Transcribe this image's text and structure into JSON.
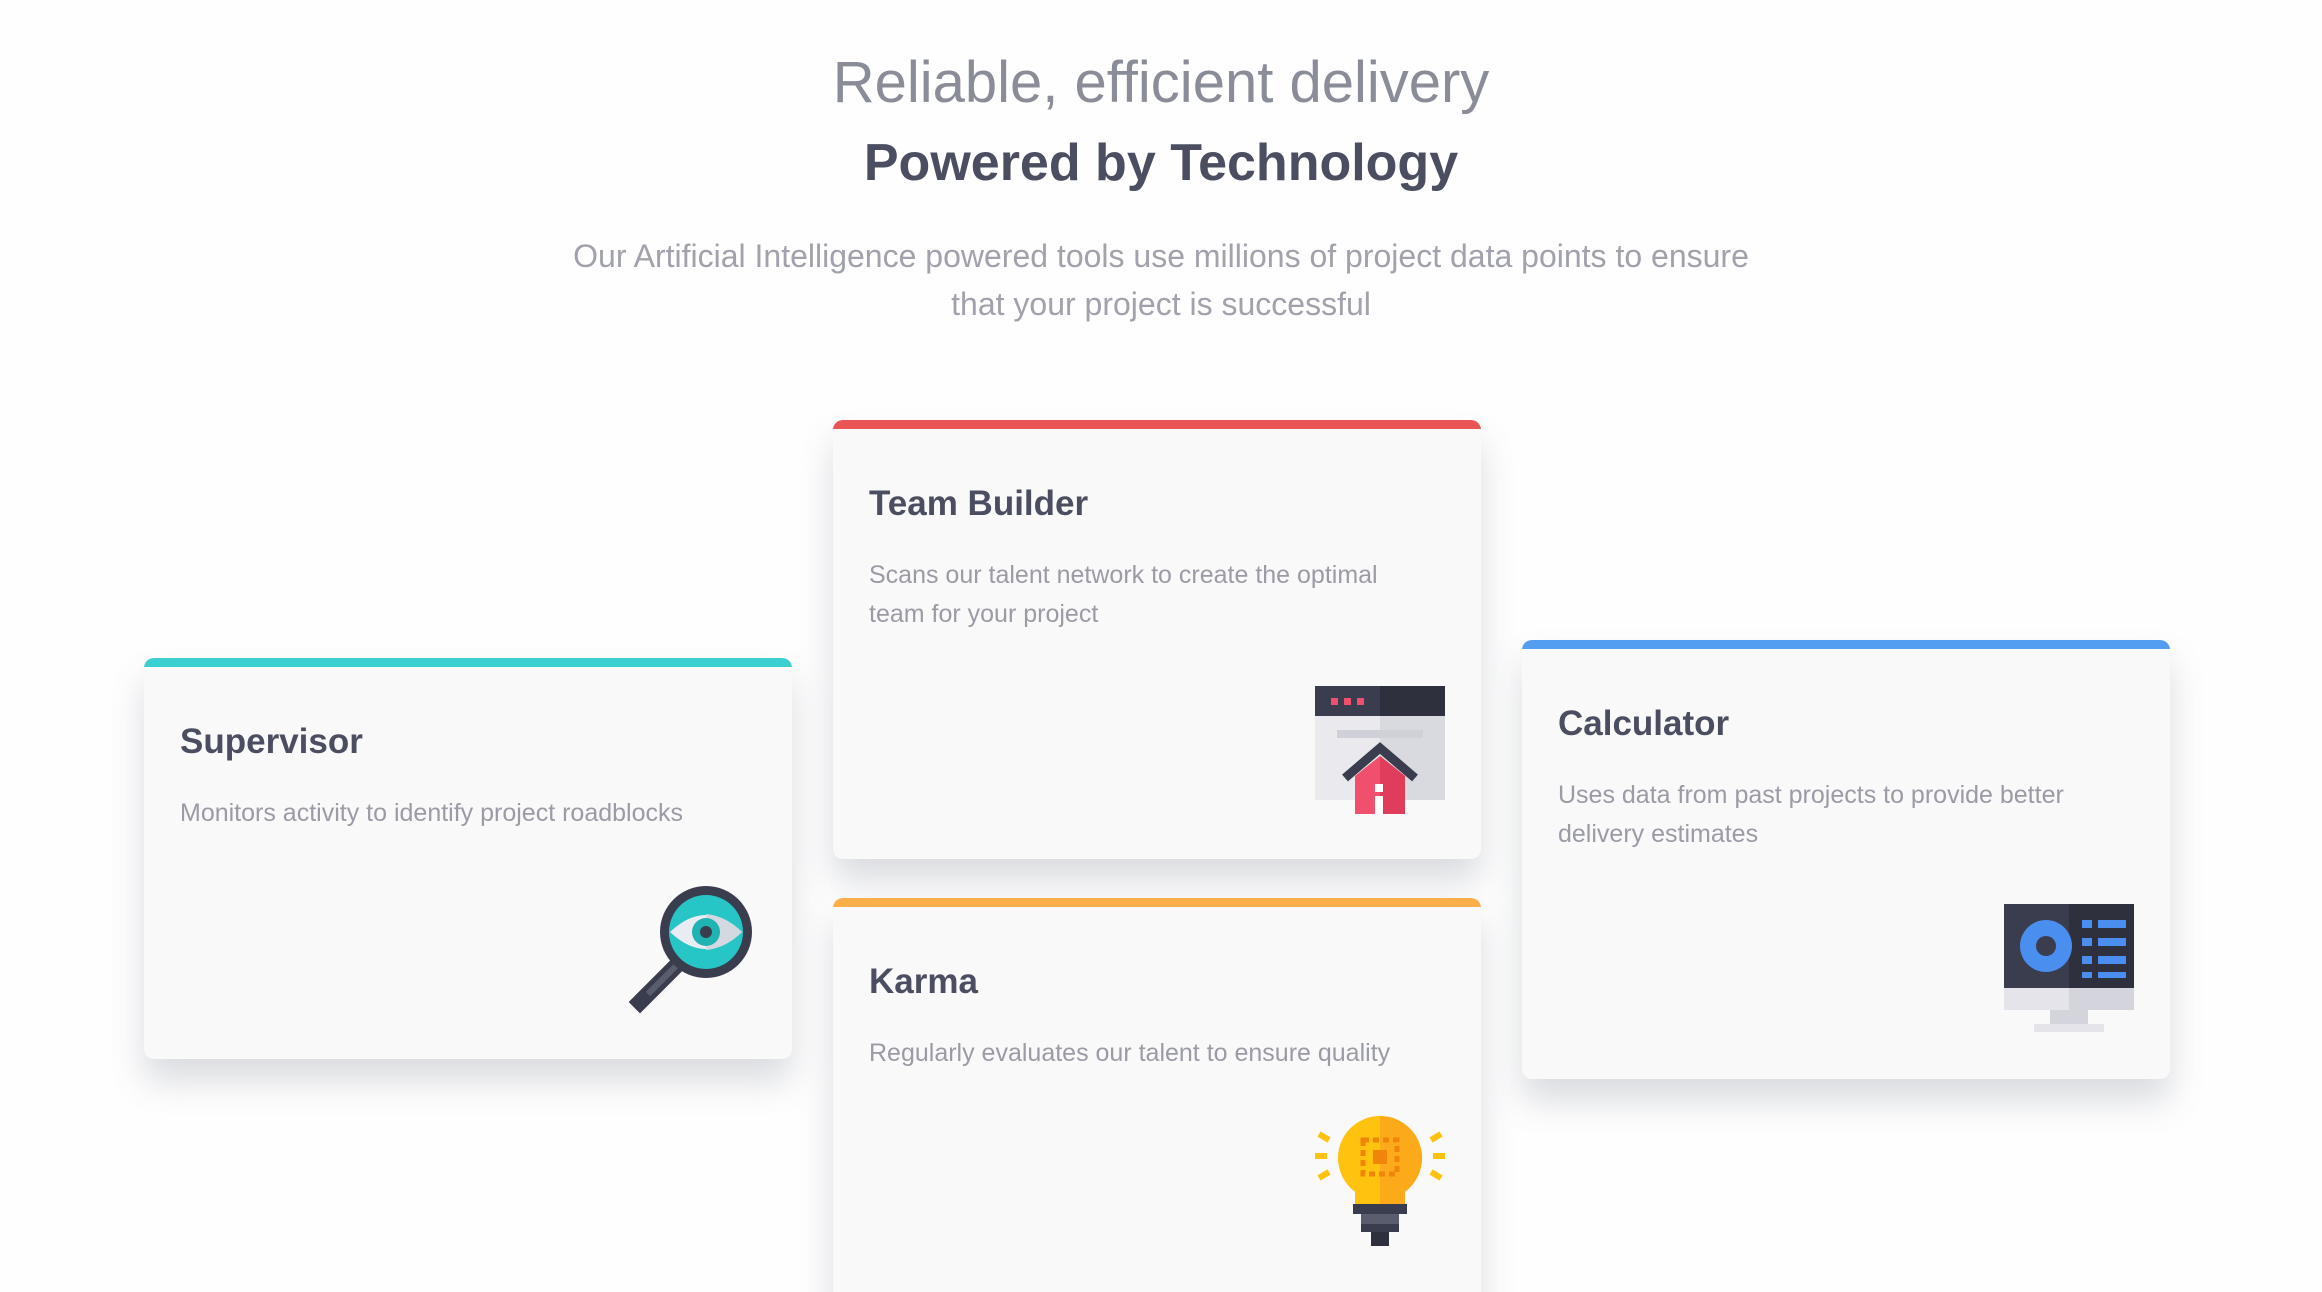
{
  "header": {
    "tagline": "Reliable, efficient delivery",
    "title": "Powered by Technology",
    "intro": "Our Artificial Intelligence powered tools use millions of project data points to ensure that your project is successful"
  },
  "cards": {
    "supervisor": {
      "title": "Supervisor",
      "description": "Monitors activity to identify project roadblocks",
      "accent": "#3ccfcf",
      "icon": "magnifier-eye-icon"
    },
    "team_builder": {
      "title": "Team Builder",
      "description": "Scans our talent network to create the optimal team for your project",
      "accent": "#ea5454",
      "icon": "browser-home-icon"
    },
    "karma": {
      "title": "Karma",
      "description": "Regularly evaluates our talent to ensure quality",
      "accent": "#fcae4a",
      "icon": "lightbulb-icon"
    },
    "calculator": {
      "title": "Calculator",
      "description": "Uses data from past projects to provide better delivery estimates",
      "accent": "#549ef2",
      "icon": "monitor-dashboard-icon"
    }
  }
}
